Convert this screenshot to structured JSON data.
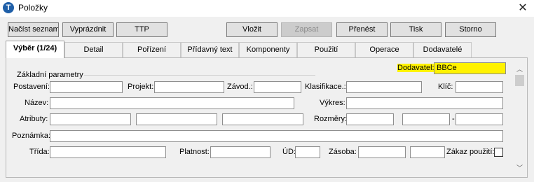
{
  "window": {
    "title": "Položky",
    "app_icon_letter": "T"
  },
  "toolbar": {
    "load_list": "Načíst seznam",
    "clear": "Vyprázdnit",
    "ttp": "TTP",
    "insert": "Vložit",
    "write": "Zapsat",
    "transfer": "Přenést",
    "print": "Tisk",
    "cancel": "Storno"
  },
  "tabs": [
    {
      "label": "Výběr (1/24)",
      "active": true
    },
    {
      "label": "Detail"
    },
    {
      "label": "Pořízení"
    },
    {
      "label": "Přídavný text"
    },
    {
      "label": "Komponenty"
    },
    {
      "label": "Použití"
    },
    {
      "label": "Operace"
    },
    {
      "label": "Dodavatelé"
    }
  ],
  "form": {
    "group_title": "Základní parametry",
    "supplier_label": "Dodavatel:",
    "supplier_value": "BBCe",
    "placement_label": "Postavení:",
    "project_label": "Projekt:",
    "plant_label": "Závod.:",
    "classification_label": "Klasifikace.:",
    "key_label": "Klíč:",
    "name_label": "Název:",
    "drawing_label": "Výkres:",
    "attributes_label": "Atributy:",
    "dimensions_label": "Rozměry:",
    "dimension_separator": "-",
    "note_label": "Poznámka:",
    "class_label": "Třída:",
    "validity_label": "Platnost:",
    "ud_label": "ÚD:",
    "stock_label": "Zásoba:",
    "ban_use_label": "Zákaz použití:"
  },
  "colors": {
    "highlight": "#fff200",
    "accent": "#1f5fa8"
  }
}
